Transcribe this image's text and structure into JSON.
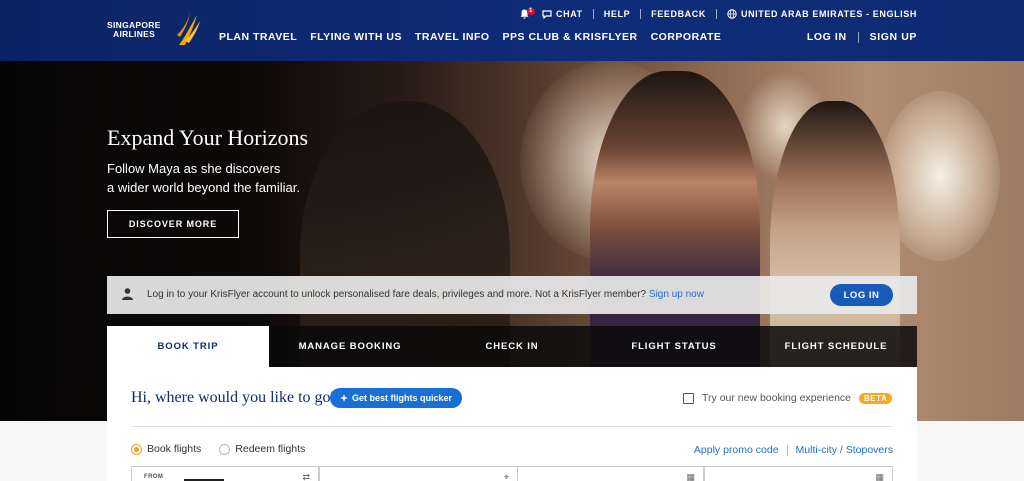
{
  "header": {
    "logo": {
      "line1": "SINGAPORE",
      "line2": "AIRLINES"
    },
    "topbar": {
      "notifications_count": "1",
      "chat": "CHAT",
      "help": "HELP",
      "feedback": "FEEDBACK",
      "region": "UNITED ARAB EMIRATES - ENGLISH"
    },
    "nav": [
      "PLAN TRAVEL",
      "FLYING WITH US",
      "TRAVEL INFO",
      "PPS CLUB & KRISFLYER",
      "CORPORATE"
    ],
    "auth": {
      "login": "LOG IN",
      "signup": "SIGN UP"
    }
  },
  "hero": {
    "title": "Expand Your Horizons",
    "subtitle_line1": "Follow Maya as she discovers",
    "subtitle_line2": "a wider world beyond the familiar.",
    "cta": "DISCOVER MORE"
  },
  "login_strip": {
    "message": "Log in to your KrisFlyer account to unlock personalised fare deals, privileges and more. Not a KrisFlyer member?",
    "signup_link": "Sign up now",
    "button": "LOG IN"
  },
  "tabs": [
    "BOOK TRIP",
    "MANAGE BOOKING",
    "CHECK IN",
    "FLIGHT STATUS",
    "FLIGHT SCHEDULE"
  ],
  "active_tab": "BOOK TRIP",
  "booking": {
    "greeting": "Hi, where would you like to go?",
    "quick_pill": "Get best flights quicker",
    "try_new": "Try our new booking experience",
    "beta": "BETA",
    "radio_book": "Book flights",
    "radio_redeem": "Redeem flights",
    "promo": "Apply promo code",
    "multicity": "Multi-city / Stopovers",
    "from_label": "FROM"
  },
  "colors": {
    "brand_navy": "#0f2a73",
    "accent_blue": "#1a5bb8",
    "accent_gold": "#f7a823"
  }
}
